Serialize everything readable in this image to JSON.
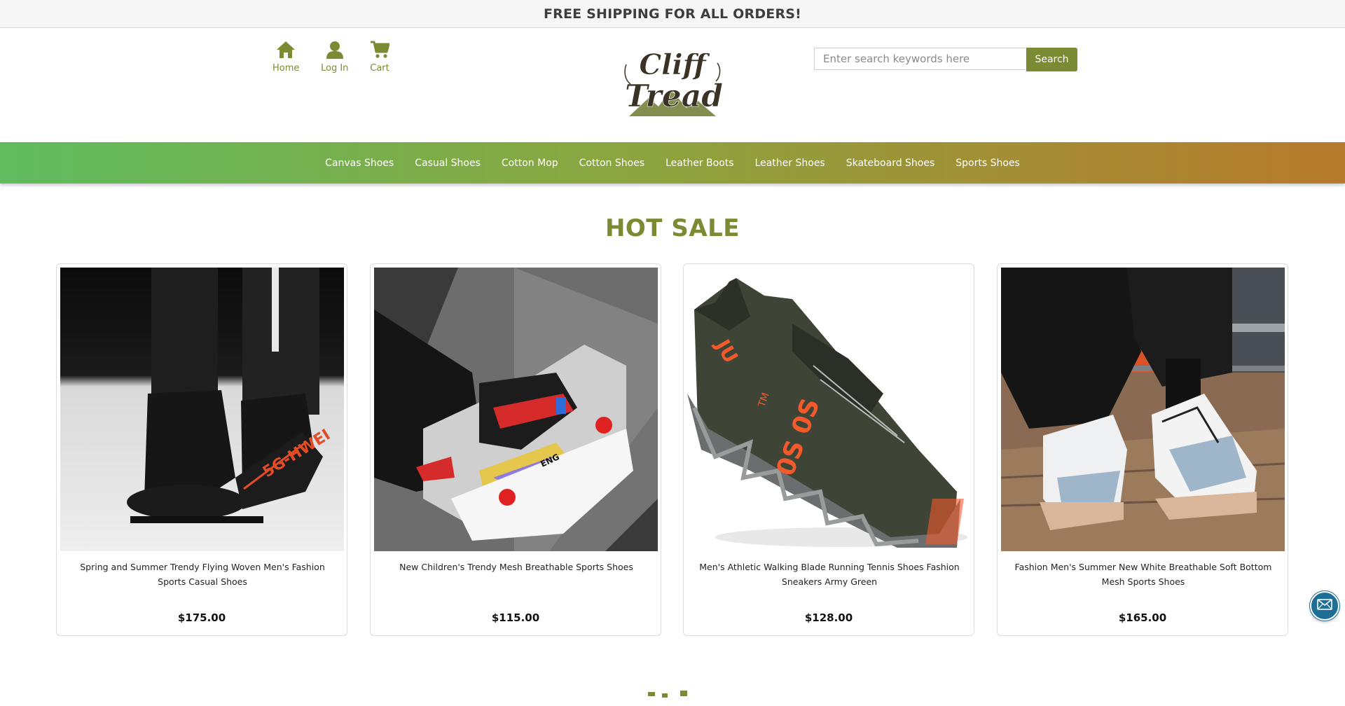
{
  "announcement": "FREE SHIPPING FOR ALL ORDERS!",
  "header": {
    "links": [
      {
        "label": "Home",
        "icon": "home-icon"
      },
      {
        "label": "Log In",
        "icon": "user-icon"
      },
      {
        "label": "Cart",
        "icon": "cart-icon"
      }
    ],
    "logo": {
      "line1": "Cliff",
      "line2": "Tread"
    },
    "search": {
      "placeholder": "Enter search keywords here",
      "button_label": "Search"
    }
  },
  "categories": [
    "Canvas Shoes",
    "Casual Shoes",
    "Cotton Mop",
    "Cotton Shoes",
    "Leather Boots",
    "Leather Shoes",
    "Skateboard Shoes",
    "Sports Shoes"
  ],
  "hot_sale": {
    "title": "HOT SALE",
    "products": [
      {
        "name": "Spring and Summer Trendy Flying Woven Men's Fashion Sports Casual Shoes",
        "price": "$175.00"
      },
      {
        "name": "New Children's Trendy Mesh Breathable Sports Shoes",
        "price": "$115.00"
      },
      {
        "name": "Men's Athletic Walking Blade Running Tennis Shoes Fashion Sneakers Army Green",
        "price": "$128.00"
      },
      {
        "name": "Fashion Men's Summer New White Breathable Soft Bottom Mesh Sports Shoes",
        "price": "$165.00"
      }
    ]
  },
  "colors": {
    "brand_olive": "#7a8b34",
    "nav_gradient_start": "#5fbc5f",
    "nav_gradient_end": "#b77a2c",
    "mail_button": "#1f6e96"
  }
}
